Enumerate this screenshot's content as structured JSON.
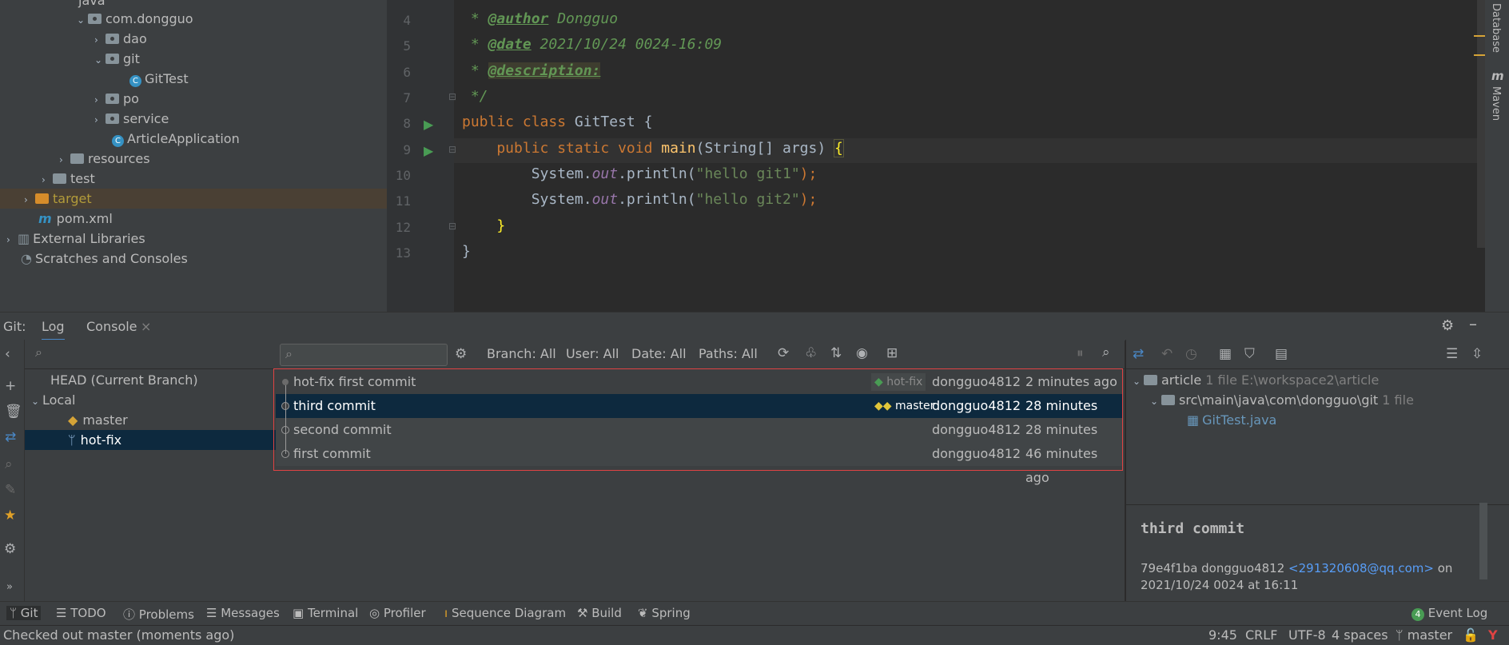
{
  "project_tree": {
    "items": [
      {
        "label": "java"
      },
      {
        "label": "com.dongguo"
      },
      {
        "label": "dao"
      },
      {
        "label": "git"
      },
      {
        "label": "GitTest"
      },
      {
        "label": "po"
      },
      {
        "label": "service"
      },
      {
        "label": "ArticleApplication"
      },
      {
        "label": "resources"
      },
      {
        "label": "test"
      },
      {
        "label": "target"
      },
      {
        "label": "pom.xml"
      },
      {
        "label": "External Libraries"
      },
      {
        "label": "Scratches and Consoles"
      }
    ]
  },
  "editor": {
    "line_numbers": [
      "4",
      "5",
      "6",
      "7",
      "8",
      "9",
      "10",
      "11",
      "12",
      "13"
    ],
    "lines": {
      "l4_star": " * ",
      "l4_tag": "@author",
      "l4_rest": " Dongguo",
      "l5_star": " * ",
      "l5_tag": "@date",
      "l5_rest": " 2021/10/24 0024-16:09",
      "l6_star": " * ",
      "l6_tag": "@description:",
      "l7": " */",
      "l8_kw": "public class ",
      "l8_plain": "GitTest {",
      "l9_kw": "    public static void ",
      "l9_fn": "main",
      "l9_plain": "(String[] args) ",
      "l9_brace": "{",
      "l10_a": "        System.",
      "l10_fld": "out",
      "l10_b": ".println(",
      "l10_str": "\"hello git1\"",
      "l10_c": ");",
      "l11_a": "        System.",
      "l11_fld": "out",
      "l11_b": ".println(",
      "l11_str": "\"hello git2\"",
      "l11_c": ");",
      "l12": "    }",
      "l13": "}"
    }
  },
  "right_strip": {
    "database": "Database",
    "maven": "Maven"
  },
  "git_window": {
    "title": "Git:",
    "tabs": [
      "Log",
      "Console"
    ],
    "branches": {
      "head": "HEAD (Current Branch)",
      "local": "Local",
      "items": [
        "master",
        "hot-fix"
      ]
    },
    "filters": {
      "branch": "Branch: All",
      "user": "User: All",
      "date": "Date: All",
      "paths": "Paths: All"
    },
    "commits": [
      {
        "message": "hot-fix first commit",
        "tag": "hot-fix",
        "author": "dongguo4812",
        "time": "2 minutes ago"
      },
      {
        "message": "third commit",
        "tag": "master",
        "author": "dongguo4812",
        "time": "28 minutes ago"
      },
      {
        "message": "second commit",
        "tag": "",
        "author": "dongguo4812",
        "time": "28 minutes ago"
      },
      {
        "message": "first commit",
        "tag": "",
        "author": "dongguo4812",
        "time": "46 minutes ago"
      }
    ],
    "details": {
      "root": "article",
      "root_meta": "1 file  E:\\workspace2\\article",
      "path": "src\\main\\java\\com\\dongguo\\git",
      "path_meta": "1 file",
      "file": "GitTest.java",
      "commit_title": "third commit",
      "commit_hash_author": "79e4f1ba dongguo4812 ",
      "commit_email": "<291320608@qq.com>",
      "commit_on": " on",
      "commit_date": "2021/10/24 0024 at 16:11"
    }
  },
  "tool_windows": [
    "Git",
    "TODO",
    "Problems",
    "Messages",
    "Terminal",
    "Profiler",
    "Sequence Diagram",
    "Build",
    "Spring"
  ],
  "event_log": {
    "count": "4",
    "label": "Event Log"
  },
  "status": {
    "message": "Checked out master (moments ago)",
    "position": "9:45",
    "line_sep": "CRLF",
    "encoding": "UTF-8",
    "indent": "4 spaces",
    "branch": "master"
  },
  "colors": {
    "accent": "#3592c4",
    "selection": "#0d293e",
    "highlight_box": "#e04343"
  }
}
